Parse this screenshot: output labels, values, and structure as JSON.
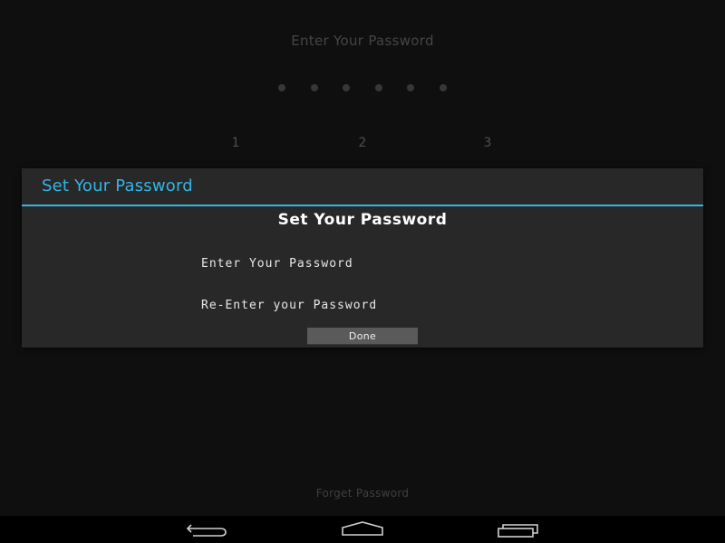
{
  "background": {
    "title": "Enter Your Password",
    "pin_dot_count": 6,
    "keypad": [
      "1",
      "2",
      "3"
    ],
    "forgot_link": "Forget Password"
  },
  "dialog": {
    "header_title": "Set Your Password",
    "heading": "Set Your Password",
    "password_placeholder": "Enter Your Password",
    "reenter_placeholder": "Re-Enter your Password",
    "done_label": "Done"
  },
  "colors": {
    "accent": "#33b5e5",
    "dialog_bg": "#282828",
    "screen_bg": "#141414",
    "button_bg": "#5a5a5a"
  },
  "navbar": {
    "icons": [
      "back-icon",
      "home-icon",
      "recents-icon"
    ]
  }
}
